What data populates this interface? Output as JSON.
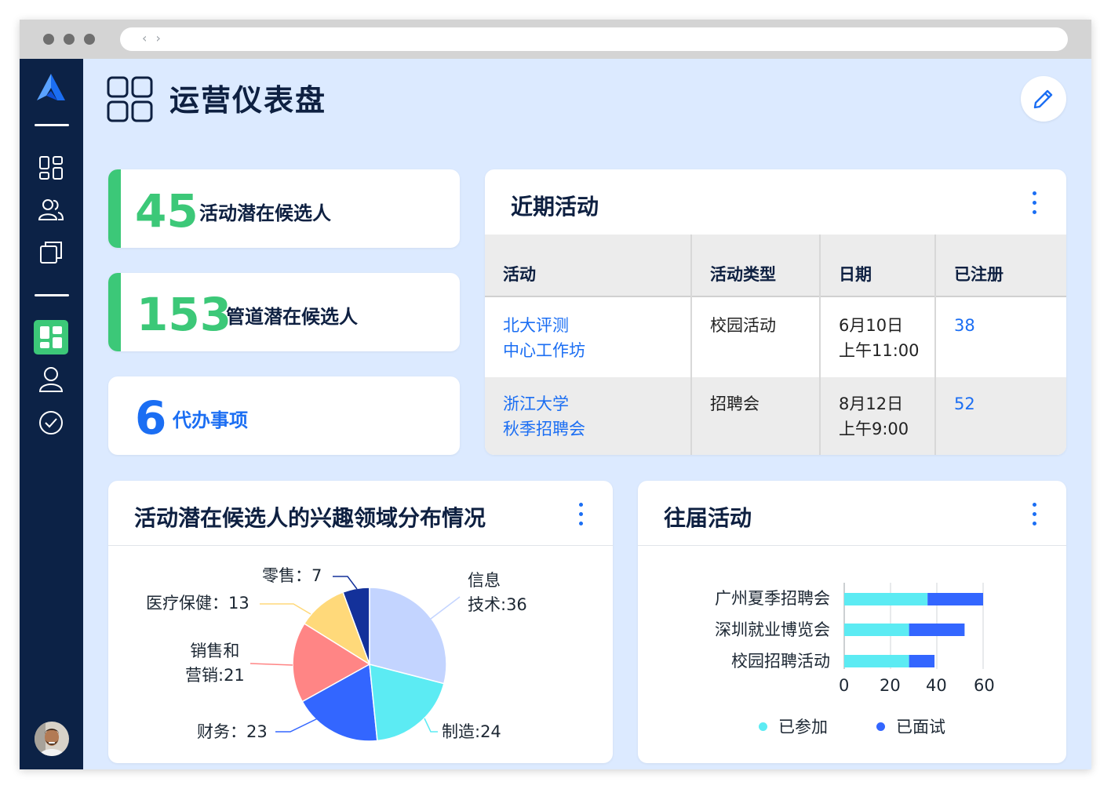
{
  "page": {
    "title": "运营仪表盘"
  },
  "browser": {
    "nav_glyph": "‹ ›"
  },
  "sidebar": {
    "items": [
      {
        "icon": "grid-icon",
        "active": false
      },
      {
        "icon": "users-icon",
        "active": false
      },
      {
        "icon": "folders-icon",
        "active": false
      },
      {
        "icon": "dashboard-icon",
        "active": true
      },
      {
        "icon": "user-icon",
        "active": false
      },
      {
        "icon": "check-circle-icon",
        "active": false
      }
    ]
  },
  "stats": [
    {
      "value": "45",
      "label": "活动潜在候选人",
      "color": "#3cc878"
    },
    {
      "value": "153",
      "label": "管道潜在候选人",
      "color": "#3cc878"
    },
    {
      "value": "6",
      "label": "代办事项",
      "color": "#1b6ef3"
    }
  ],
  "recent_events": {
    "title": "近期活动",
    "columns": [
      "活动",
      "活动类型",
      "日期",
      "已注册"
    ],
    "rows": [
      {
        "name": [
          "北大评测",
          "中心工作坊"
        ],
        "type": "校园活动",
        "date": [
          "6月10日",
          "上午11:00"
        ],
        "registered": "38"
      },
      {
        "name": [
          "浙江大学",
          "秋季招聘会"
        ],
        "type": "招聘会",
        "date": [
          "8月12日",
          "上午9:00"
        ],
        "registered": "52"
      }
    ]
  },
  "interest_chart": {
    "title": "活动潜在候选人的兴趣领域分布情况",
    "labels": {
      "it": [
        "信息",
        "技术:36"
      ],
      "manufacturing": "制造:24",
      "finance": "财务：23",
      "sales": [
        "销售和",
        "营销:21"
      ],
      "healthcare": "医疗保健：13",
      "retail": "零售：7"
    }
  },
  "past_events": {
    "title": "往届活动",
    "x_ticks": [
      "0",
      "20",
      "40",
      "60"
    ],
    "legend": [
      "已参加",
      "已面试"
    ]
  },
  "chart_data": [
    {
      "type": "pie",
      "title": "活动潜在候选人的兴趣领域分布情况",
      "slices": [
        {
          "name": "信息技术",
          "value": 36,
          "color": "#c3d4ff"
        },
        {
          "name": "制造",
          "value": 24,
          "color": "#5cebf3"
        },
        {
          "name": "财务",
          "value": 23,
          "color": "#3366ff"
        },
        {
          "name": "销售和营销",
          "value": 21,
          "color": "#ff8585"
        },
        {
          "name": "医疗保健",
          "value": 13,
          "color": "#ffd97a"
        },
        {
          "name": "零售",
          "value": 7,
          "color": "#13319a"
        }
      ]
    },
    {
      "type": "bar",
      "orientation": "horizontal",
      "stacked": true,
      "title": "往届活动",
      "categories": [
        "广州夏季招聘会",
        "深圳就业博览会",
        "校园招聘活动"
      ],
      "series": [
        {
          "name": "已参加",
          "values": [
            36,
            28,
            28
          ],
          "color": "#5cebf3"
        },
        {
          "name": "已面试",
          "values": [
            24,
            24,
            11
          ],
          "color": "#3366ff"
        }
      ],
      "xlim": [
        0,
        60
      ],
      "x_ticks": [
        0,
        20,
        40,
        60
      ],
      "grid": true,
      "legend_position": "bottom"
    }
  ]
}
